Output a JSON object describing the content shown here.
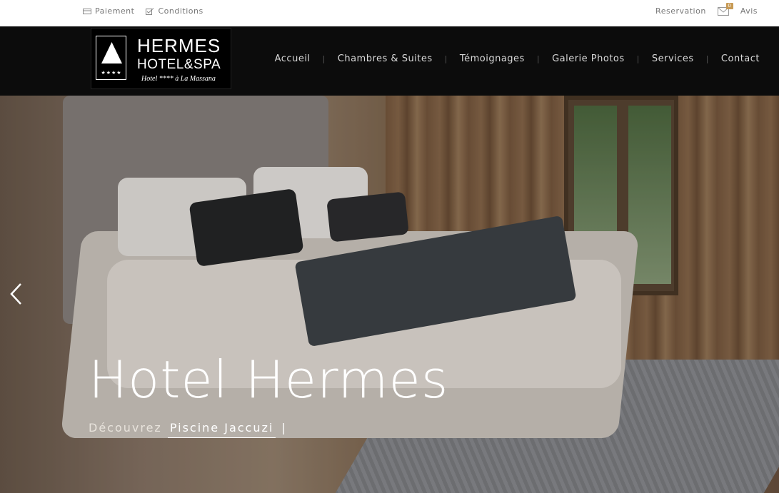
{
  "topbar": {
    "left": [
      {
        "label": "Paiement",
        "icon": "card-icon"
      },
      {
        "label": "Conditions",
        "icon": "checkbox-icon"
      }
    ],
    "right": {
      "reservation": "Reservation",
      "mail_badge": "0",
      "avis": "Avis"
    }
  },
  "logo": {
    "line1": "HERMES",
    "line2": "HOTEL&SPA",
    "line3": "Hotel **** à La Massana",
    "stars": "★★★★"
  },
  "nav": {
    "items": [
      "Accueil",
      "Chambres & Suites",
      "Témoignages",
      "Galerie Photos",
      "Services",
      "Contact"
    ],
    "separator": "|"
  },
  "hero": {
    "title": "Hotel Hermes",
    "subtitle_prefix": "Découvrez",
    "subtitle_typed": "Piscine Jaccuzi",
    "caret": "|"
  },
  "colors": {
    "accent": "#c79a55",
    "navbar": "#0c0c0c"
  }
}
